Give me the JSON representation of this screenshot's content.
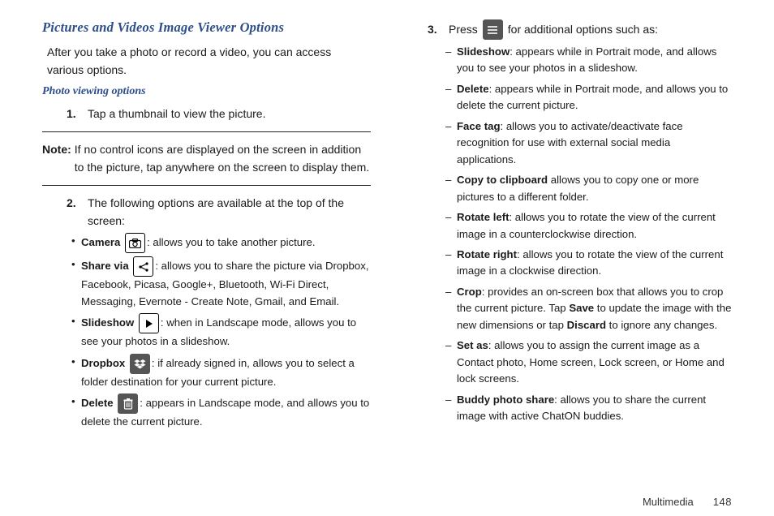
{
  "headings": {
    "h1": "Pictures and Videos Image Viewer Options",
    "intro": "After you take a photo or record a video, you can access various options.",
    "h2": "Photo viewing options"
  },
  "step1": {
    "num": "1.",
    "text": "Tap a thumbnail to view the picture."
  },
  "note": {
    "label": "Note:",
    "text": "If no control icons are displayed on the screen in addition to the picture, tap anywhere on the screen to display them."
  },
  "step2": {
    "num": "2.",
    "text": "The following options are available at the top of the screen:"
  },
  "bullets": {
    "camera": {
      "label": "Camera",
      "desc": ": allows you to take another picture."
    },
    "share": {
      "label": "Share via",
      "desc": ": allows you to share the picture via Dropbox, Facebook, Picasa, Google+, Bluetooth, Wi-Fi Direct, Messaging, Evernote - Create Note, Gmail, and Email."
    },
    "slide": {
      "label": "Slideshow",
      "desc": ": when in Landscape mode, allows you to see your photos in a slideshow."
    },
    "dropbox": {
      "label": "Dropbox",
      "desc": ": if already signed in, allows you to select a folder destination for your current picture."
    },
    "delete": {
      "label": "Delete",
      "desc": ": appears in Landscape mode, and allows you to delete the current picture."
    }
  },
  "step3": {
    "num": "3.",
    "a": "Press",
    "b": "for additional options such as:"
  },
  "dashes": {
    "d1": {
      "label": "Slideshow",
      "desc": ": appears while in Portrait mode, and allows you to see your photos in a slideshow."
    },
    "d2": {
      "label": "Delete",
      "desc": ": appears while in Portrait mode, and allows you to delete the current picture."
    },
    "d3": {
      "label": "Face tag",
      "desc": ": allows you to activate/deactivate face recognition for use with external social media applications."
    },
    "d4": {
      "label": "Copy to clipboard",
      "desc": " allows you to copy one or more pictures to a different folder."
    },
    "d5": {
      "label": "Rotate left",
      "desc": ": allows you to rotate the view of the current image in a counterclockwise direction."
    },
    "d6": {
      "label": "Rotate right",
      "desc": ": allows you to rotate the view of the current image in a clockwise direction."
    },
    "d7": {
      "label": "Crop",
      "a": ": provides an on-screen box that allows you to crop the current picture. Tap ",
      "save": "Save",
      "b": " to update the image with the new dimensions or tap ",
      "discard": "Discard",
      "c": " to ignore any changes."
    },
    "d8": {
      "label": "Set as",
      "desc": ": allows you to assign the current image as a Contact photo, Home screen, Lock screen, or Home and lock screens."
    },
    "d9": {
      "label": "Buddy photo share",
      "desc": ": allows you to share the current image with active ChatON buddies."
    }
  },
  "footer": {
    "section": "Multimedia",
    "page": "148"
  }
}
